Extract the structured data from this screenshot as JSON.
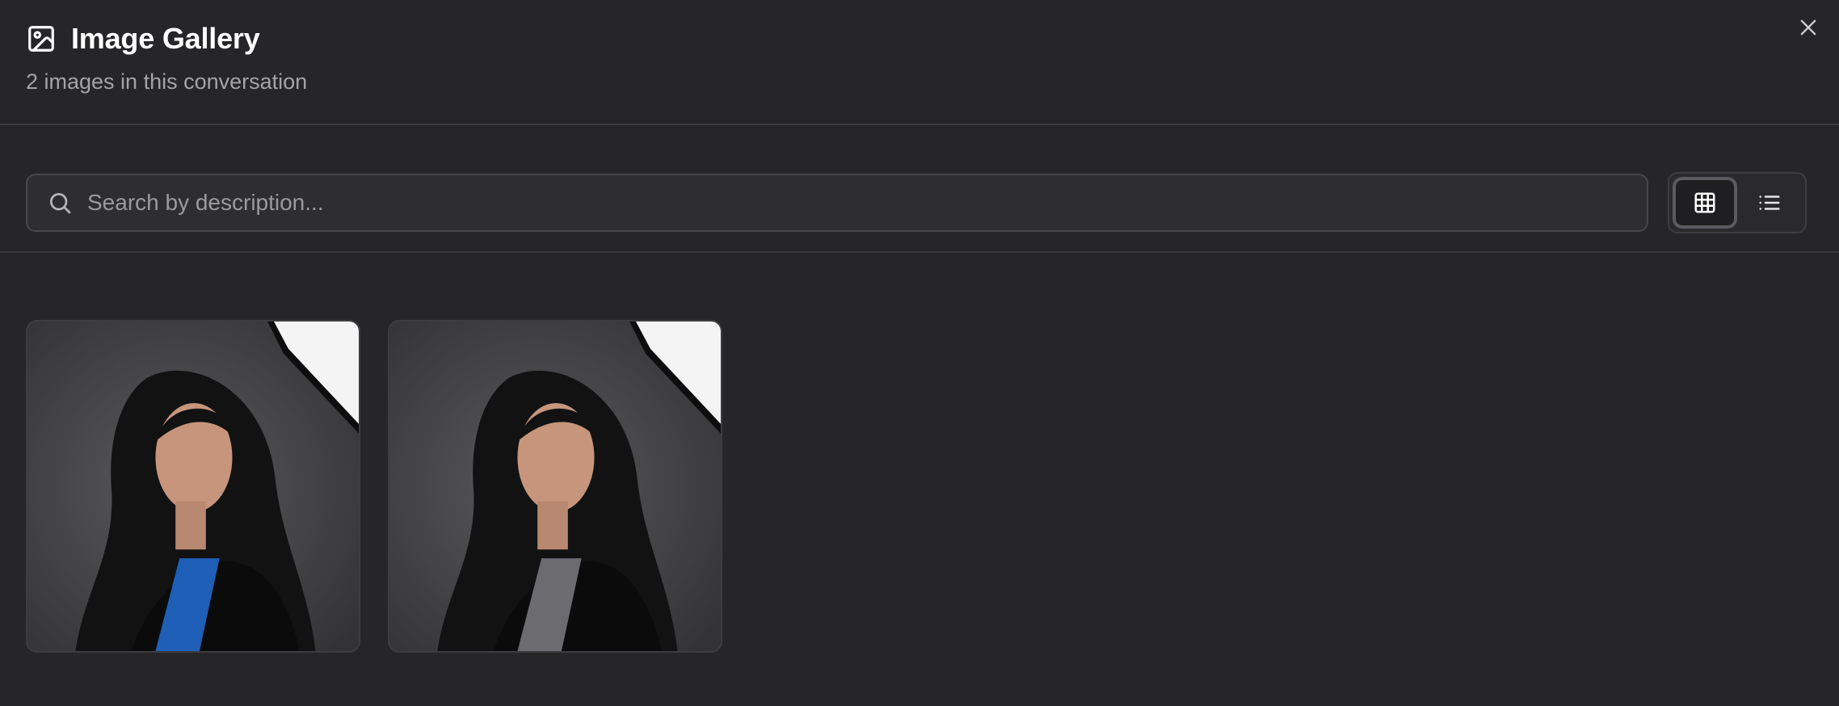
{
  "header": {
    "title": "Image Gallery",
    "subtitle": "2 images in this conversation",
    "title_icon": "image-icon",
    "close_icon": "close-icon"
  },
  "search": {
    "placeholder": "Search by description...",
    "value": "",
    "icon": "search-icon"
  },
  "view_toggle": {
    "options": [
      {
        "icon": "grid-icon",
        "selected": true
      },
      {
        "icon": "list-icon",
        "selected": false
      }
    ]
  },
  "gallery": {
    "images": [
      {
        "top_color": "#1f5fb8"
      },
      {
        "top_color": "#6b6b70"
      }
    ]
  },
  "colors": {
    "background": "#262628",
    "divider": "#3b3b3e",
    "search_bg": "#2e2e31",
    "text_primary": "#ffffff",
    "text_secondary": "#a3a3a8"
  }
}
